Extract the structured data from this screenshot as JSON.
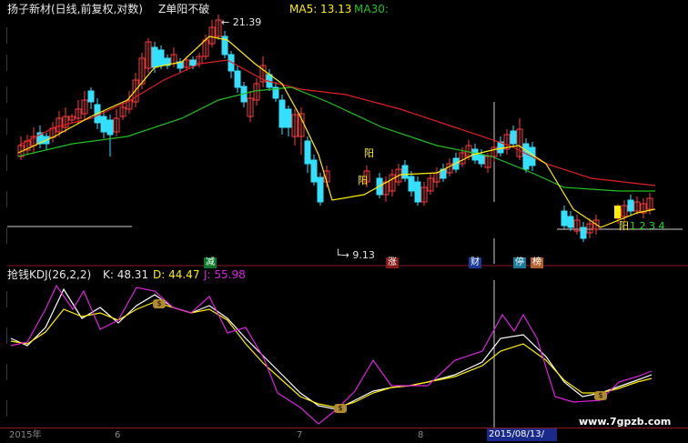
{
  "header": {
    "title": "扬子新材(日线,前复权,对数)",
    "formula": "Z单阳不破",
    "ma5_label": "MA5: 13.13",
    "ma30_label": "MA30:"
  },
  "price_labels": {
    "high": "21.39",
    "low": "9.13"
  },
  "main_tags": {
    "jian": "减",
    "zhang": "涨",
    "cai": "财",
    "ting": "停",
    "bang": "榜",
    "yang1": "阳",
    "yang2": "阳",
    "yang3": "阳",
    "seq": "1 2 3 4"
  },
  "kdj": {
    "title": "抢钱KDJ(26,2,2)",
    "k": "K: 48.31",
    "d": "D: 44.47",
    "j": "J: 55.98"
  },
  "axis": {
    "labels": [
      "2015年",
      "6",
      "7",
      "8"
    ],
    "selected_date": "2015/08/13/"
  },
  "watermark": "www.7gpzb.com",
  "colors": {
    "up": "#ff3c3c",
    "down": "#33e0ff",
    "ma5": "#ffee00",
    "ma_red": "#e02020",
    "ma_green": "#20c020",
    "k": "#ffffff",
    "d": "#ffee00",
    "j": "#e020e0"
  },
  "chart_data": {
    "type": "candlestick",
    "candles": [
      [
        19,
        16.5,
        16,
        17.5
      ],
      [
        23,
        17,
        16.8,
        18
      ],
      [
        27,
        17.4,
        17,
        18.1
      ],
      [
        31,
        17.6,
        17.5,
        18.4
      ],
      [
        35,
        18.1,
        17.3,
        18.5
      ],
      [
        39,
        17.9,
        17.9,
        18.6
      ],
      [
        43,
        18.2,
        17.9,
        18.8
      ],
      [
        47,
        18.3,
        18.1,
        18.9
      ],
      [
        51,
        18.6,
        18.2,
        19.4
      ],
      [
        55,
        18.9,
        18.5,
        19.4
      ],
      [
        59,
        19.0,
        18.6,
        19.8
      ],
      [
        63,
        19.2,
        18.8,
        20.3
      ],
      [
        67,
        19.7,
        19.2,
        20.1
      ],
      [
        71,
        19.8,
        19.3,
        20.3
      ],
      [
        75,
        19.9,
        19.5,
        20.3
      ],
      [
        79,
        19.7,
        19.3,
        20.1
      ],
      [
        83,
        19.7,
        19.5,
        20.8
      ],
      [
        87,
        20.3,
        19.8,
        21.1
      ],
      [
        91,
        20.5,
        20.0,
        21.4
      ],
      [
        95,
        20.7,
        20.3,
        21.6
      ],
      [
        99,
        21.0,
        20.5,
        21.7
      ],
      [
        103,
        20.6,
        20.3,
        21.2
      ],
      [
        107,
        20.4,
        20.0,
        20.8
      ],
      [
        111,
        20.2,
        19.8,
        20.6
      ],
      [
        115,
        19.8,
        17.8,
        20.2
      ],
      [
        119,
        18.8,
        18.3,
        19.3
      ],
      [
        123,
        18.9,
        18.6,
        19.9
      ],
      [
        127,
        19.6,
        18.9,
        19.8
      ],
      [
        131,
        19.6,
        19.3,
        20.1
      ],
      [
        135,
        19.9,
        19.6,
        20.4
      ],
      [
        139,
        20.1,
        19.5,
        20.6
      ],
      [
        143,
        20.7,
        20.3,
        21.2
      ],
      [
        147,
        21.0,
        20.6,
        21.6
      ],
      [
        151,
        21.1,
        20.8,
        21.8
      ],
      [
        155,
        21.3,
        21.1,
        21.5
      ],
      [
        159,
        21.3,
        21.2,
        21.8
      ],
      [
        163,
        21.6,
        21.3,
        22.1
      ],
      [
        167,
        21.9,
        21.5,
        22.0
      ],
      [
        171,
        21.8,
        21.4,
        22.4
      ],
      [
        175,
        21.9,
        21.0,
        22.4
      ],
      [
        179,
        21.3,
        21.0,
        21.7
      ],
      [
        183,
        21.3,
        21.0,
        21.6
      ],
      [
        187,
        21.1,
        20.9,
        21.5
      ],
      [
        191,
        21.3,
        20.9,
        21.7
      ],
      [
        195,
        21.2,
        20.8,
        21.3
      ],
      [
        199,
        20.8,
        20.6,
        21.3
      ],
      [
        203,
        20.8,
        20.5,
        21.4
      ],
      [
        207,
        21.3,
        21.0,
        21.5
      ],
      [
        211,
        21.4,
        21.0,
        21.8
      ],
      [
        215,
        21.5,
        21.1,
        21.9
      ],
      [
        219,
        21.5,
        21.2,
        22.1
      ],
      [
        223,
        21.9,
        21.6,
        22.4
      ],
      [
        227,
        22.1,
        21.9,
        22.4
      ],
      [
        231,
        22.3,
        22.1,
        22.6
      ],
      [
        235,
        22.6,
        22.1,
        22.8
      ],
      [
        239,
        22.8,
        22.2,
        22.9
      ],
      [
        243,
        22.5,
        21.6,
        22.8
      ],
      [
        247,
        21.8,
        21.4,
        22.3
      ],
      [
        251,
        21.5,
        21.3,
        21.9
      ],
      [
        255,
        21.4,
        21.1,
        21.6
      ],
      [
        259,
        21.1,
        20.6,
        21.4
      ],
      [
        263,
        20.8,
        20.4,
        21.1
      ],
      [
        267,
        20.3,
        19.8,
        20.6
      ],
      [
        271,
        20.1,
        19.5,
        20.4
      ],
      [
        275,
        19.6,
        19.3,
        20.0
      ],
      [
        279,
        19.3,
        19.1,
        19.6
      ],
      [
        283,
        19.4,
        19.2,
        19.7
      ],
      [
        287,
        19.5,
        19.2,
        19.9
      ],
      [
        291,
        19.6,
        19.1,
        19.7
      ],
      [
        295,
        19.3,
        18.8,
        19.6
      ],
      [
        299,
        18.8,
        18.3,
        19.2
      ],
      [
        303,
        18.4,
        17.8,
        18.8
      ],
      [
        307,
        17.9,
        17.2,
        18.3
      ],
      [
        311,
        17.5,
        16.8,
        17.9
      ],
      [
        315,
        17.2,
        16.6,
        17.7
      ],
      [
        319,
        16.8,
        15.9,
        17.2
      ],
      [
        323,
        16.3,
        15.7,
        17.0
      ],
      [
        327,
        16.0,
        15.6,
        16.7
      ],
      [
        331,
        15.8,
        14.6,
        16.3
      ],
      [
        335,
        15.0,
        14.4,
        15.4
      ],
      [
        339,
        14.6,
        14.3,
        15.0
      ],
      [
        343,
        14.3,
        14.1,
        14.7
      ],
      [
        347,
        14.5,
        14.2,
        14.9
      ],
      [
        351,
        14.7,
        14.3,
        15.0
      ],
      [
        355,
        14.8,
        14.4,
        15.1
      ]
    ]
  }
}
